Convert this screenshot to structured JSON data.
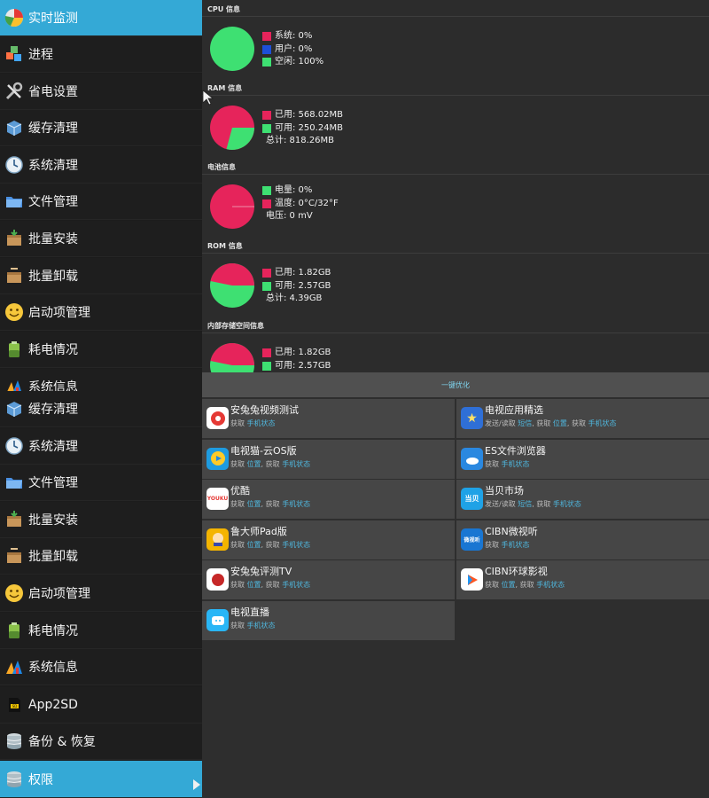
{
  "sidebar": {
    "items": [
      {
        "label": "实时监测",
        "icon": "pie-chart-icon",
        "active": true
      },
      {
        "label": "进程",
        "icon": "cubes-icon"
      },
      {
        "label": "省电设置",
        "icon": "tools-icon"
      },
      {
        "label": "缓存清理",
        "icon": "box-icon"
      },
      {
        "label": "系统清理",
        "icon": "clock-icon"
      },
      {
        "label": "文件管理",
        "icon": "folder-icon"
      },
      {
        "label": "批量安装",
        "icon": "package-install-icon"
      },
      {
        "label": "批量卸载",
        "icon": "package-uninstall-icon"
      },
      {
        "label": "启动项管理",
        "icon": "smiley-icon"
      },
      {
        "label": "耗电情况",
        "icon": "battery-icon"
      },
      {
        "label": "系统信息",
        "icon": "system-info-icon"
      },
      {
        "label": "缓存清理",
        "icon": "box-icon"
      },
      {
        "label": "系统清理",
        "icon": "clock-icon"
      },
      {
        "label": "文件管理",
        "icon": "folder-icon"
      },
      {
        "label": "批量安装",
        "icon": "package-install-icon"
      },
      {
        "label": "批量卸载",
        "icon": "package-uninstall-icon"
      },
      {
        "label": "启动项管理",
        "icon": "smiley-icon"
      },
      {
        "label": "耗电情况",
        "icon": "battery-icon"
      },
      {
        "label": "系统信息",
        "icon": "system-info-icon"
      },
      {
        "label": "App2SD",
        "icon": "sd-card-icon"
      },
      {
        "label": "备份 & 恢复",
        "icon": "database-icon"
      },
      {
        "label": "权限",
        "icon": "database-icon",
        "active": true
      }
    ]
  },
  "colors": {
    "accent": "#34a9d6",
    "pink": "#e6245b",
    "green": "#3ee072",
    "blue": "#1d4fd8"
  },
  "sections": {
    "cpu": {
      "title": "CPU 信息",
      "legend": [
        "系统: 0%",
        "用户: 0%",
        "空闲: 100%"
      ]
    },
    "ram": {
      "title": "RAM 信息",
      "legend": [
        "已用: 568.02MB",
        "可用: 250.24MB",
        "总计: 818.26MB"
      ]
    },
    "battery": {
      "title": "电池信息",
      "legend": [
        "电量: 0%",
        "温度: 0°C/32°F",
        "电压: 0 mV"
      ]
    },
    "rom": {
      "title": "ROM 信息",
      "legend": [
        "已用: 1.82GB",
        "可用: 2.57GB",
        "总计: 4.39GB"
      ]
    },
    "storage": {
      "title": "内部存储空间信息",
      "legend": [
        "已用: 1.82GB",
        "可用: 2.57GB"
      ]
    }
  },
  "dialog": {
    "title": "一键优化",
    "apps": [
      {
        "name": "安兔兔视频测试",
        "perm": [
          {
            "t": "获取 "
          },
          {
            "t": "手机状态",
            "hl": true
          }
        ],
        "icon": "antutu-video-icon"
      },
      {
        "name": "电视应用精选",
        "perm": [
          {
            "t": "发送/读取 "
          },
          {
            "t": "短信",
            "hl": true
          },
          {
            "t": ", 获取 "
          },
          {
            "t": "位置",
            "hl": true
          },
          {
            "t": ", 获取 "
          },
          {
            "t": "手机状态",
            "hl": true
          }
        ],
        "icon": "tv-apps-icon"
      },
      {
        "name": "电视猫-云OS版",
        "perm": [
          {
            "t": "获取 "
          },
          {
            "t": "位置",
            "hl": true
          },
          {
            "t": ", 获取 "
          },
          {
            "t": "手机状态",
            "hl": true
          }
        ],
        "icon": "tvcat-icon"
      },
      {
        "name": "ES文件浏览器",
        "perm": [
          {
            "t": "获取 "
          },
          {
            "t": "手机状态",
            "hl": true
          }
        ],
        "icon": "es-explorer-icon"
      },
      {
        "name": "优酷",
        "perm": [
          {
            "t": "获取 "
          },
          {
            "t": "位置",
            "hl": true
          },
          {
            "t": ", 获取 "
          },
          {
            "t": "手机状态",
            "hl": true
          }
        ],
        "icon": "youku-icon"
      },
      {
        "name": "当贝市场",
        "perm": [
          {
            "t": "发送/读取 "
          },
          {
            "t": "短信",
            "hl": true
          },
          {
            "t": ", 获取 "
          },
          {
            "t": "手机状态",
            "hl": true
          }
        ],
        "icon": "dangbei-icon"
      },
      {
        "name": "鲁大师Pad版",
        "perm": [
          {
            "t": "获取 "
          },
          {
            "t": "位置",
            "hl": true
          },
          {
            "t": ", 获取 "
          },
          {
            "t": "手机状态",
            "hl": true
          }
        ],
        "icon": "ludashi-icon"
      },
      {
        "name": "CIBN微视听",
        "perm": [
          {
            "t": "获取 "
          },
          {
            "t": "手机状态",
            "hl": true
          }
        ],
        "icon": "cibn-weishiting-icon"
      },
      {
        "name": "安兔兔评测TV",
        "perm": [
          {
            "t": "获取 "
          },
          {
            "t": "位置",
            "hl": true
          },
          {
            "t": ", 获取 "
          },
          {
            "t": "手机状态",
            "hl": true
          }
        ],
        "icon": "antutu-tv-icon"
      },
      {
        "name": "CIBN环球影视",
        "perm": [
          {
            "t": "获取 "
          },
          {
            "t": "位置",
            "hl": true
          },
          {
            "t": ", 获取 "
          },
          {
            "t": "手机状态",
            "hl": true
          }
        ],
        "icon": "cibn-global-icon"
      },
      {
        "name": "电视直播",
        "perm": [
          {
            "t": "获取 "
          },
          {
            "t": "手机状态",
            "hl": true
          }
        ],
        "icon": "tv-live-icon"
      }
    ]
  }
}
